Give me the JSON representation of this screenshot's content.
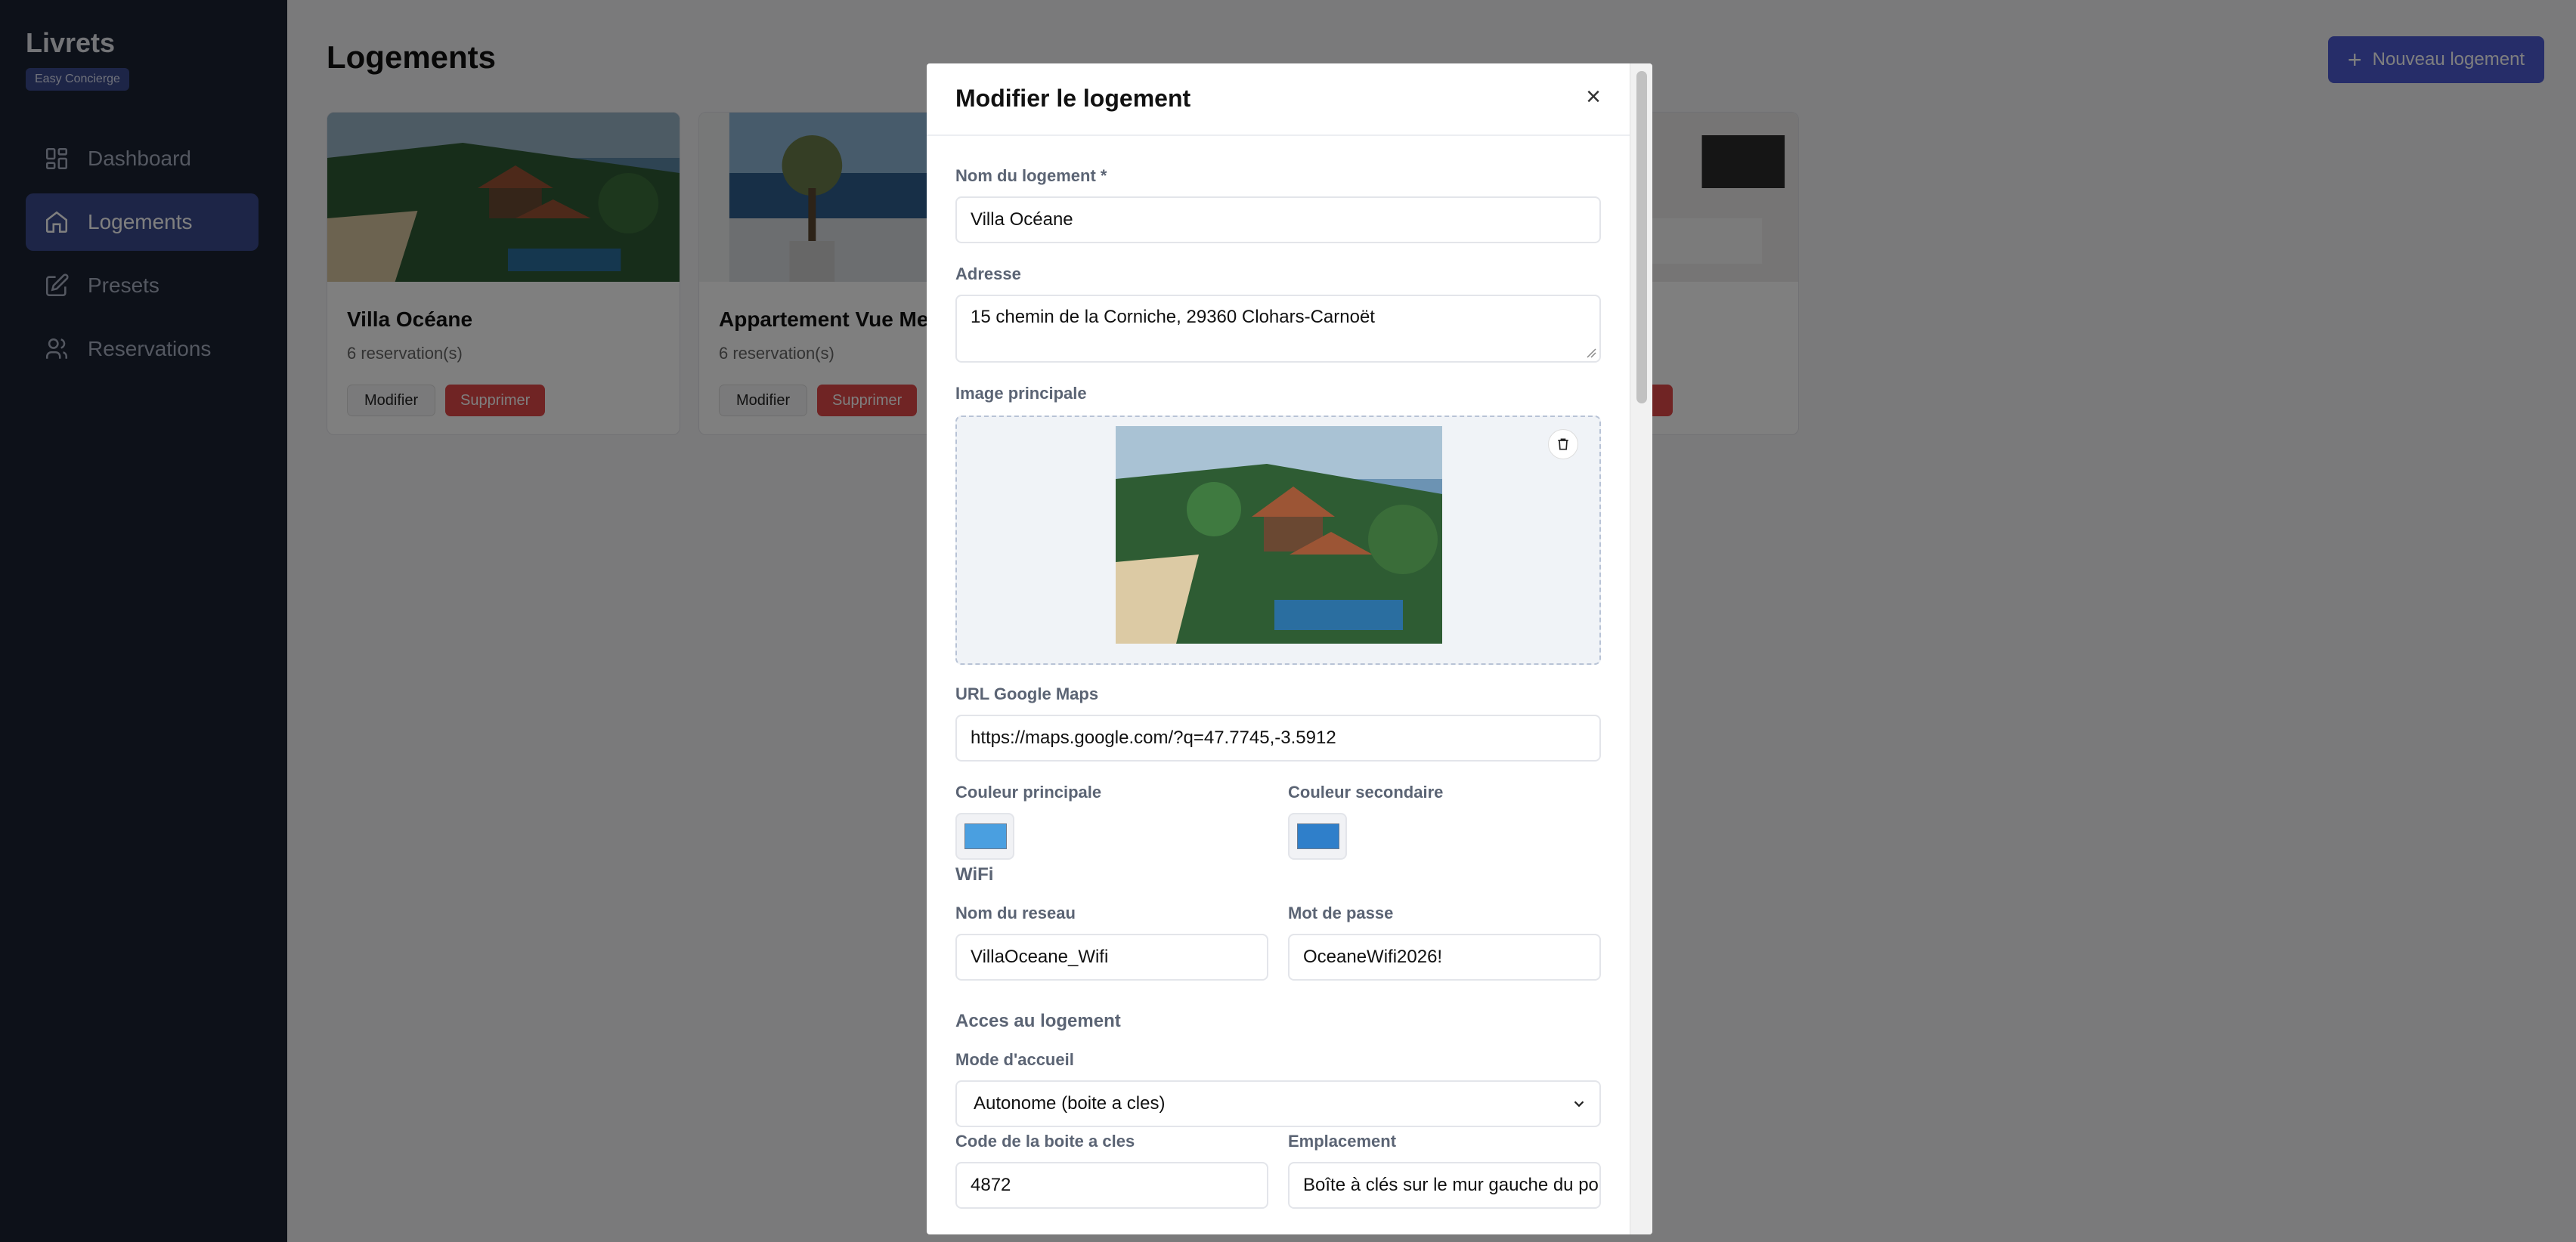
{
  "sidebar": {
    "brand": "Livrets",
    "badge": "Easy Concierge",
    "items": [
      {
        "label": "Dashboard",
        "icon": "dashboard-icon"
      },
      {
        "label": "Logements",
        "icon": "home-icon"
      },
      {
        "label": "Presets",
        "icon": "edit-icon"
      },
      {
        "label": "Reservations",
        "icon": "users-icon"
      }
    ],
    "active_index": 1
  },
  "main": {
    "title": "Logements",
    "new_button": "Nouveau logement",
    "cards": [
      {
        "name": "Villa Océane",
        "reservations": "6 reservation(s)",
        "edit": "Modifier",
        "delete": "Supprimer"
      },
      {
        "name": "Appartement Vue Mer",
        "reservations": "6 reservation(s)",
        "edit": "Modifier",
        "delete": "Supprimer"
      },
      {
        "name": "",
        "reservations": "",
        "edit": "",
        "delete": ""
      }
    ]
  },
  "modal": {
    "title": "Modifier le logement",
    "close": "×",
    "name_label": "Nom du logement *",
    "name_value": "Villa Océane",
    "address_label": "Adresse",
    "address_value": "15 chemin de la Corniche, 29360 Clohars-Carnoët",
    "image_label": "Image principale",
    "maps_label": "URL Google Maps",
    "maps_value": "https://maps.google.com/?q=47.7745,-3.5912",
    "primary_color_label": "Couleur principale",
    "primary_color": "#4a9fe0",
    "secondary_color_label": "Couleur secondaire",
    "secondary_color": "#2f7fca",
    "wifi_title": "WiFi",
    "network_label": "Nom du reseau",
    "network_value": "VillaOceane_Wifi",
    "password_label": "Mot de passe",
    "password_value": "OceaneWifi2026!",
    "access_title": "Acces au logement",
    "mode_label": "Mode d'accueil",
    "mode_value": "Autonome (boite a cles)",
    "code_label": "Code de la boite a cles",
    "code_value": "4872",
    "location_label": "Emplacement",
    "location_value": "Boîte à clés sur le mur gauche du portail"
  },
  "colors": {
    "sidebar_bg": "#1a2233",
    "accent": "#3b4a8f",
    "primary_button": "#4c5ad3",
    "danger": "#e04848"
  }
}
